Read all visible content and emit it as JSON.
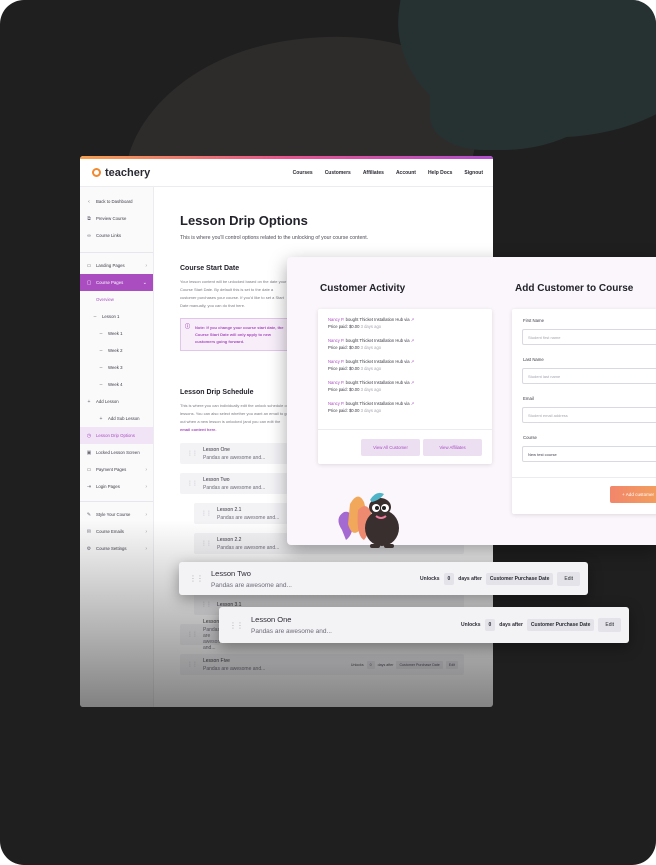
{
  "brand": {
    "name": "teachery"
  },
  "topnav": [
    "Courses",
    "Customers",
    "Affiliates",
    "Account",
    "Help Docs",
    "Signout"
  ],
  "sidebar": {
    "items": [
      {
        "icon": "‹",
        "label": "Back to Dashboard"
      },
      {
        "icon": "⧉",
        "label": "Preview Course"
      },
      {
        "icon": "∞",
        "label": "Course Links"
      }
    ],
    "pages": [
      {
        "icon": "▭",
        "label": "Landing Pages",
        "chev": "›"
      },
      {
        "icon": "▢",
        "label": "Course Pages",
        "chev": "⌄"
      }
    ],
    "course_tree": [
      {
        "label": "Overview",
        "level": 1
      },
      {
        "label": "Lesson 1",
        "level": 0
      },
      {
        "label": "Week 1",
        "level": 1
      },
      {
        "label": "Week 2",
        "level": 1
      },
      {
        "label": "Week 3",
        "level": 1
      },
      {
        "label": "Week 4",
        "level": 1
      },
      {
        "label": "Add Lesson",
        "level": 0
      },
      {
        "label": "Add Sub Lesson",
        "level": 1
      },
      {
        "label": "Lesson Drip Options",
        "level": 0
      },
      {
        "label": "Locked Lesson Screen",
        "level": 0
      }
    ],
    "more": [
      {
        "icon": "▭",
        "label": "Payment Pages",
        "chev": "›"
      },
      {
        "icon": "⇥",
        "label": "Login Pages",
        "chev": "›"
      }
    ],
    "settings": [
      {
        "icon": "✎",
        "label": "Style Your Course",
        "chev": "›"
      },
      {
        "icon": "✉",
        "label": "Course Emails",
        "chev": "›"
      },
      {
        "icon": "⚙",
        "label": "Course Settings",
        "chev": "›"
      }
    ]
  },
  "main": {
    "title": "Lesson Drip Options",
    "subtitle": "This is where you'll control options related to the unlocking of your course content.",
    "start_date": {
      "heading": "Course Start Date",
      "body": "Your lesson content will be unlocked based on the date your Course Start Date. By default this is set to the date a customer purchases your course. If you'd like to set a Start Date manually, you can do that here.",
      "note": "Note: If you change your course start date, the Course Start Date will only apply to new customers going forward."
    },
    "schedule": {
      "heading": "Lesson Drip Schedule",
      "body": "This is where you can individually edit the unlock schedule of lessons. You can also select whether you want an email to go out when a new lesson is unlocked (and you can edit the",
      "link": "email content here."
    },
    "lessons": [
      {
        "title": "Lesson One",
        "desc": "Pandas are awesome and..."
      },
      {
        "title": "Lesson Two",
        "desc": "Pandas are awesome and..."
      },
      {
        "title": "Lesson 2.1",
        "desc": "Pandas are awesome and..."
      },
      {
        "title": "Lesson 2.2",
        "desc": "Pandas are awesome and..."
      },
      {
        "title": "Lesson 3.1",
        "desc": ""
      },
      {
        "title": "Lesson F",
        "desc": "Pandas are awesome and..."
      },
      {
        "title": "Lesson Five",
        "desc": "Pandas are awesome and..."
      }
    ],
    "drip_ctl": {
      "unlocks": "Unlocks",
      "days": "0",
      "after": "days after",
      "trigger": "Customer Purchase Date",
      "edit": "Edit"
    }
  },
  "activity": {
    "heading": "Customer Activity",
    "entries": [
      {
        "name": "Nancy P.",
        "verb": "bought",
        "product": "Thicket Installation Hub",
        "via": "via",
        "price": "Price paid: $0.00",
        "ago": "3 days ago"
      },
      {
        "name": "Nancy P.",
        "verb": "bought",
        "product": "Thicket Installation Hub",
        "via": "via",
        "price": "Price paid: $0.00",
        "ago": "3 days ago"
      },
      {
        "name": "Nancy P.",
        "verb": "bought",
        "product": "Thicket Installation Hub",
        "via": "via",
        "price": "Price paid: $0.00",
        "ago": "3 days ago"
      },
      {
        "name": "Nancy P.",
        "verb": "bought",
        "product": "Thicket Installation Hub",
        "via": "via",
        "price": "Price paid: $0.00",
        "ago": "3 days ago"
      },
      {
        "name": "Nancy P.",
        "verb": "bought",
        "product": "Thicket Installation Hub",
        "via": "via",
        "price": "Price paid: $0.00",
        "ago": "3 days ago"
      }
    ],
    "view_all": "View All Customer",
    "view_aff": "View Affiliates"
  },
  "add_customer": {
    "heading": "Add Customer to Course",
    "first_label": "First Name",
    "first_ph": "Student first name",
    "last_label": "Last Name",
    "last_ph": "Student last name",
    "email_label": "Email",
    "email_ph": "Student email address",
    "course_label": "Course",
    "course_value": "New test course",
    "submit": "+ Add customer"
  },
  "float_cards": [
    {
      "title": "Lesson Two",
      "desc": "Pandas are awesome and...",
      "unlocks": "Unlocks",
      "days": "0",
      "after": "days after",
      "trigger": "Customer Purchase Date",
      "edit": "Edit"
    },
    {
      "title": "Lesson One",
      "desc": "Pandas are awesome and...",
      "unlocks": "Unlocks",
      "days": "0",
      "after": "days after",
      "trigger": "Customer Purchase Date",
      "edit": "Edit"
    }
  ],
  "colors": {
    "accent": "#a94dc0",
    "button": "#f2866b",
    "background": "#1f1f1f"
  }
}
